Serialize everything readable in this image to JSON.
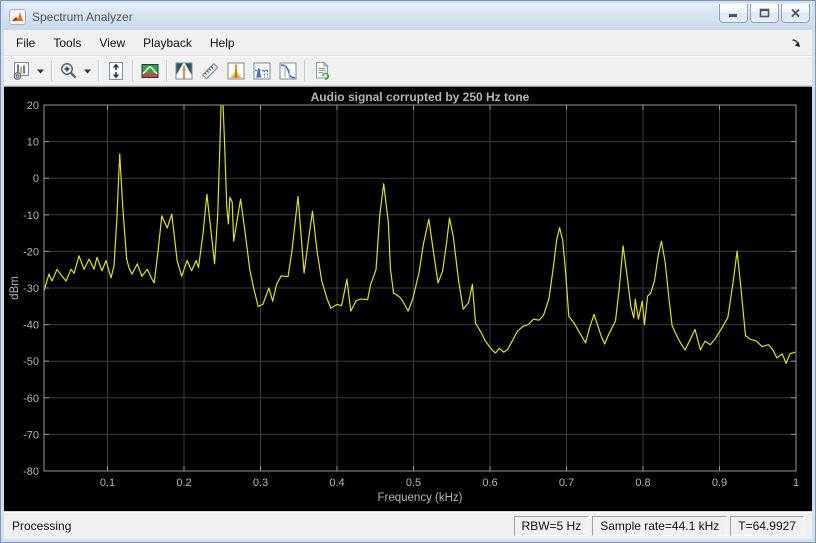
{
  "window": {
    "title": "Spectrum Analyzer"
  },
  "menu": {
    "items": [
      "File",
      "Tools",
      "View",
      "Playback",
      "Help"
    ]
  },
  "toolbar": {
    "buttons": [
      {
        "icon": "configuration-icon",
        "has_dropdown": true
      },
      {
        "icon": "zoom-in-icon",
        "has_dropdown": true
      },
      {
        "icon": "scale-y-axis-icon"
      },
      {
        "icon": "spectrum-settings-icon"
      },
      {
        "icon": "spectral-mask-icon"
      },
      {
        "icon": "cursor-measurements-icon"
      },
      {
        "icon": "peak-finder-icon"
      },
      {
        "icon": "distortion-measurements-icon"
      },
      {
        "icon": "ccdf-measurements-icon"
      },
      {
        "icon": "generate-script-icon"
      }
    ]
  },
  "chart_data": {
    "type": "line",
    "title": "Audio signal corrupted by 250 Hz tone",
    "xlabel": "Frequency (kHz)",
    "ylabel": "dBm",
    "xlim": [
      0.017,
      1.0
    ],
    "ylim": [
      -80,
      20
    ],
    "xticks": [
      0.1,
      0.2,
      0.3,
      0.4,
      0.5,
      0.6,
      0.7,
      0.8,
      0.9,
      1
    ],
    "yticks": [
      20,
      10,
      0,
      -10,
      -20,
      -30,
      -40,
      -50,
      -60,
      -70,
      -80
    ],
    "grid": true,
    "background": "#000000",
    "grid_color": "#3d3d3d",
    "axis_color": "#969696",
    "label_color": "#b5b5b5",
    "series": [
      {
        "name": "spectrum-trace",
        "color": "#e0e01e",
        "points": [
          [
            0.017,
            -30.8
          ],
          [
            0.0236,
            -26.2
          ],
          [
            0.0275,
            -28.1
          ],
          [
            0.034,
            -24.9
          ],
          [
            0.0406,
            -26.8
          ],
          [
            0.0458,
            -28.1
          ],
          [
            0.0523,
            -24.9
          ],
          [
            0.0563,
            -26.0
          ],
          [
            0.0628,
            -21.2
          ],
          [
            0.0693,
            -24.9
          ],
          [
            0.0759,
            -22.1
          ],
          [
            0.0824,
            -24.9
          ],
          [
            0.0863,
            -21.6
          ],
          [
            0.0928,
            -25.3
          ],
          [
            0.0981,
            -22.5
          ],
          [
            0.1046,
            -27.2
          ],
          [
            0.1085,
            -24.0
          ],
          [
            0.112,
            -12.0
          ],
          [
            0.116,
            6.6
          ],
          [
            0.12,
            -8.0
          ],
          [
            0.125,
            -22.0
          ],
          [
            0.128,
            -24.4
          ],
          [
            0.132,
            -26.2
          ],
          [
            0.139,
            -23.4
          ],
          [
            0.145,
            -26.8
          ],
          [
            0.152,
            -24.9
          ],
          [
            0.157,
            -27.1
          ],
          [
            0.161,
            -28.6
          ],
          [
            0.166,
            -20.0
          ],
          [
            0.171,
            -10.3
          ],
          [
            0.178,
            -13.6
          ],
          [
            0.184,
            -9.8
          ],
          [
            0.191,
            -22.5
          ],
          [
            0.197,
            -26.8
          ],
          [
            0.204,
            -22.5
          ],
          [
            0.21,
            -25.3
          ],
          [
            0.216,
            -22.5
          ],
          [
            0.219,
            -24.4
          ],
          [
            0.225,
            -15.0
          ],
          [
            0.23,
            -4.4
          ],
          [
            0.235,
            -14.0
          ],
          [
            0.24,
            -23.4
          ],
          [
            0.244,
            -10.0
          ],
          [
            0.247,
            10.0
          ],
          [
            0.2495,
            28.0
          ],
          [
            0.253,
            10.0
          ],
          [
            0.256,
            -8.0
          ],
          [
            0.258,
            -12.5
          ],
          [
            0.26,
            -5.2
          ],
          [
            0.263,
            -6.5
          ],
          [
            0.265,
            -17.2
          ],
          [
            0.269,
            -12.0
          ],
          [
            0.274,
            -5.7
          ],
          [
            0.28,
            -15.0
          ],
          [
            0.286,
            -25.0
          ],
          [
            0.291,
            -30.0
          ],
          [
            0.297,
            -35.0
          ],
          [
            0.303,
            -34.5
          ],
          [
            0.311,
            -30.0
          ],
          [
            0.316,
            -33.6
          ],
          [
            0.321,
            -29.0
          ],
          [
            0.327,
            -26.7
          ],
          [
            0.336,
            -26.9
          ],
          [
            0.341,
            -20.0
          ],
          [
            0.349,
            -5.0
          ],
          [
            0.354,
            -18.0
          ],
          [
            0.357,
            -25.9
          ],
          [
            0.362,
            -18.0
          ],
          [
            0.368,
            -9.0
          ],
          [
            0.374,
            -20.0
          ],
          [
            0.38,
            -28.0
          ],
          [
            0.387,
            -33.0
          ],
          [
            0.392,
            -35.5
          ],
          [
            0.4,
            -34.5
          ],
          [
            0.406,
            -34.8
          ],
          [
            0.413,
            -27.6
          ],
          [
            0.418,
            -36.3
          ],
          [
            0.425,
            -33.5
          ],
          [
            0.431,
            -33.0
          ],
          [
            0.44,
            -33.2
          ],
          [
            0.444,
            -29.0
          ],
          [
            0.451,
            -25.0
          ],
          [
            0.456,
            -10.0
          ],
          [
            0.461,
            -1.5
          ],
          [
            0.467,
            -12.0
          ],
          [
            0.47,
            -25.0
          ],
          [
            0.474,
            -31.4
          ],
          [
            0.479,
            -32.0
          ],
          [
            0.483,
            -32.7
          ],
          [
            0.487,
            -34.0
          ],
          [
            0.493,
            -36.3
          ],
          [
            0.499,
            -33.0
          ],
          [
            0.507,
            -26.0
          ],
          [
            0.513,
            -18.0
          ],
          [
            0.52,
            -11.2
          ],
          [
            0.526,
            -20.0
          ],
          [
            0.532,
            -28.6
          ],
          [
            0.538,
            -25.4
          ],
          [
            0.543,
            -18.0
          ],
          [
            0.547,
            -10.9
          ],
          [
            0.552,
            -16.0
          ],
          [
            0.559,
            -28.0
          ],
          [
            0.565,
            -35.8
          ],
          [
            0.572,
            -34.0
          ],
          [
            0.577,
            -29.0
          ],
          [
            0.581,
            -39.6
          ],
          [
            0.588,
            -42.0
          ],
          [
            0.594,
            -44.5
          ],
          [
            0.601,
            -46.5
          ],
          [
            0.607,
            -47.8
          ],
          [
            0.612,
            -46.5
          ],
          [
            0.618,
            -47.5
          ],
          [
            0.623,
            -46.8
          ],
          [
            0.629,
            -44.5
          ],
          [
            0.636,
            -41.8
          ],
          [
            0.643,
            -40.5
          ],
          [
            0.65,
            -40.0
          ],
          [
            0.657,
            -38.5
          ],
          [
            0.664,
            -38.8
          ],
          [
            0.67,
            -37.5
          ],
          [
            0.677,
            -33.0
          ],
          [
            0.683,
            -24.0
          ],
          [
            0.687,
            -17.0
          ],
          [
            0.691,
            -13.5
          ],
          [
            0.695,
            -17.0
          ],
          [
            0.699,
            -26.0
          ],
          [
            0.703,
            -37.7
          ],
          [
            0.71,
            -39.6
          ],
          [
            0.716,
            -41.8
          ],
          [
            0.725,
            -45.0
          ],
          [
            0.73,
            -41.0
          ],
          [
            0.736,
            -37.2
          ],
          [
            0.741,
            -40.4
          ],
          [
            0.746,
            -43.5
          ],
          [
            0.75,
            -45.3
          ],
          [
            0.755,
            -42.7
          ],
          [
            0.764,
            -39.0
          ],
          [
            0.769,
            -30.0
          ],
          [
            0.774,
            -18.5
          ],
          [
            0.78,
            -28.0
          ],
          [
            0.784,
            -35.0
          ],
          [
            0.788,
            -38.2
          ],
          [
            0.79,
            -33.1
          ],
          [
            0.794,
            -38.5
          ],
          [
            0.799,
            -33.6
          ],
          [
            0.802,
            -40.0
          ],
          [
            0.806,
            -32.2
          ],
          [
            0.81,
            -31.5
          ],
          [
            0.815,
            -28.0
          ],
          [
            0.82,
            -21.0
          ],
          [
            0.824,
            -17.2
          ],
          [
            0.829,
            -23.0
          ],
          [
            0.834,
            -33.0
          ],
          [
            0.838,
            -40.3
          ],
          [
            0.844,
            -43.0
          ],
          [
            0.849,
            -45.0
          ],
          [
            0.855,
            -46.9
          ],
          [
            0.862,
            -44.0
          ],
          [
            0.868,
            -41.3
          ],
          [
            0.875,
            -46.9
          ],
          [
            0.881,
            -44.5
          ],
          [
            0.888,
            -45.5
          ],
          [
            0.894,
            -44.0
          ],
          [
            0.904,
            -40.6
          ],
          [
            0.911,
            -38.0
          ],
          [
            0.918,
            -28.0
          ],
          [
            0.923,
            -19.9
          ],
          [
            0.928,
            -30.0
          ],
          [
            0.934,
            -43.0
          ],
          [
            0.94,
            -44.0
          ],
          [
            0.948,
            -44.5
          ],
          [
            0.956,
            -46.0
          ],
          [
            0.964,
            -45.5
          ],
          [
            0.97,
            -47.0
          ],
          [
            0.975,
            -49.1
          ],
          [
            0.982,
            -48.0
          ],
          [
            0.987,
            -50.6
          ],
          [
            0.992,
            -48.0
          ],
          [
            0.999,
            -47.5
          ]
        ]
      }
    ]
  },
  "status_bar": {
    "processing": "Processing",
    "rbw": "RBW=5 Hz",
    "sample_rate": "Sample rate=44.1 kHz",
    "time": "T=64.9927"
  }
}
